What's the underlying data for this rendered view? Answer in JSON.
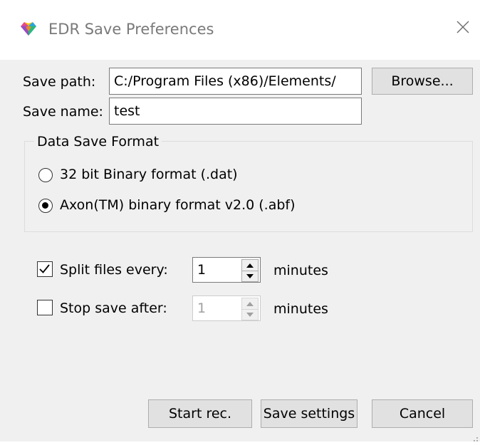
{
  "window": {
    "title": "EDR Save Preferences",
    "app_icon": "edr-multicolor-icon",
    "close_icon": "close-icon"
  },
  "save_path": {
    "label": "Save path:",
    "value": "C:/Program Files (x86)/Elements/",
    "browse_label": "Browse..."
  },
  "save_name": {
    "label": "Save name:",
    "value": "test"
  },
  "format_group": {
    "title": "Data Save Format",
    "options": [
      {
        "label": "32 bit Binary format (.dat)",
        "selected": false
      },
      {
        "label": "Axon(TM) binary format v2.0 (.abf)",
        "selected": true
      }
    ]
  },
  "split": {
    "label": "Split files every:",
    "checked": true,
    "value": "1",
    "units": "minutes",
    "enabled": true
  },
  "stop": {
    "label": "Stop save after:",
    "checked": false,
    "value": "1",
    "units": "minutes",
    "enabled": false
  },
  "buttons": {
    "start_label": "Start rec.",
    "save_label": "Save settings",
    "cancel_label": "Cancel"
  },
  "colors": {
    "window_bg": "#f0f0f0",
    "titlebar_bg": "#ffffff",
    "button_bg": "#e1e1e1",
    "title_text": "#7a7a7a"
  }
}
